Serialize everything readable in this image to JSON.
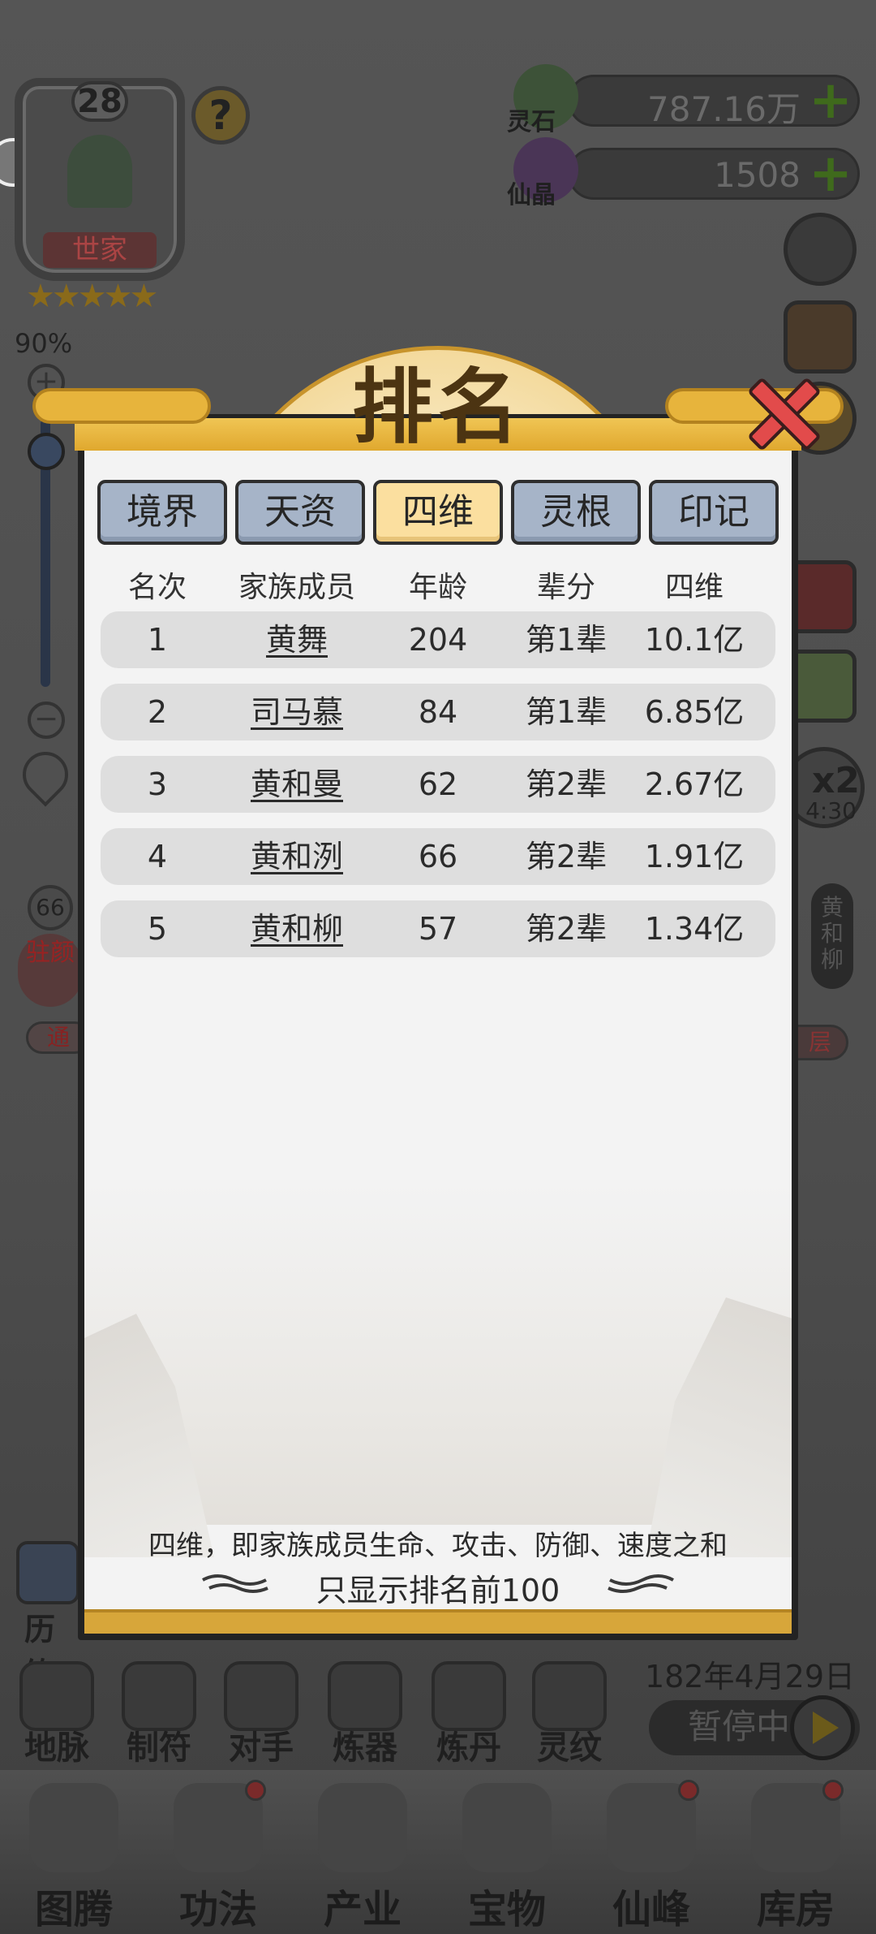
{
  "family": {
    "level": "28",
    "tag": "世家",
    "stars": "★★★★★"
  },
  "zoom": {
    "percent": "90%",
    "level_fraction": 0.88
  },
  "currencies": [
    {
      "name": "灵石",
      "value": "787.16万",
      "plus": "+"
    },
    {
      "name": "仙晶",
      "value": "1508",
      "plus": "+"
    }
  ],
  "left_panel": {
    "badge": "66",
    "circle_text": "驻颜",
    "tag": "通",
    "history_label": "历练"
  },
  "right_panel": {
    "speed": "x2",
    "speed_time": "4:30",
    "member": "黄和柳",
    "layer": "层"
  },
  "modal": {
    "title": "排名",
    "tabs": [
      "境界",
      "天资",
      "四维",
      "灵根",
      "印记"
    ],
    "active_tab": "四维",
    "columns": [
      "名次",
      "家族成员",
      "年龄",
      "辈分",
      "四维"
    ],
    "rows": [
      {
        "rank": "1",
        "member": "黄舞",
        "age": "204",
        "generation": "第1辈",
        "stat": "10.1亿"
      },
      {
        "rank": "2",
        "member": "司马慕",
        "age": "84",
        "generation": "第1辈",
        "stat": "6.85亿"
      },
      {
        "rank": "3",
        "member": "黄和曼",
        "age": "62",
        "generation": "第2辈",
        "stat": "2.67亿"
      },
      {
        "rank": "4",
        "member": "黄和洌",
        "age": "66",
        "generation": "第2辈",
        "stat": "1.91亿"
      },
      {
        "rank": "5",
        "member": "黄和柳",
        "age": "57",
        "generation": "第2辈",
        "stat": "1.34亿"
      }
    ],
    "footnote": "四维，即家族成员生命、攻击、防御、速度之和",
    "limit_note": "只显示排名前100"
  },
  "date": "182年4月29日",
  "pause_label": "暂停中",
  "tools": [
    "地脉",
    "制符",
    "对手",
    "炼器",
    "炼丹",
    "灵纹"
  ],
  "nav": [
    "图腾",
    "功法",
    "产业",
    "宝物",
    "仙峰",
    "库房"
  ],
  "colors": {
    "active_tab": "#fbdf9f",
    "tab": "#a6b4c8",
    "banner_gold": "#e7b43c",
    "close_red": "#e24b4b"
  }
}
